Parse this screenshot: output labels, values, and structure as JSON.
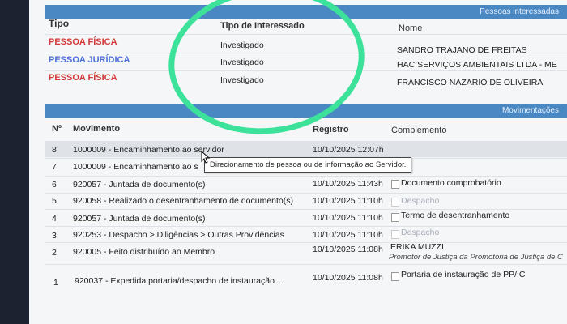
{
  "interessados": {
    "title": "Pessoas interessadas",
    "headers": {
      "tipo": "Tipo",
      "tipo_interessado": "Tipo de Interessado",
      "nome": "Nome"
    },
    "rows": [
      {
        "tipo": "PESSOA FÍSICA",
        "tipo_color": "#d23a3a",
        "interessado": "Investigado",
        "nome": "SANDRO TRAJANO DE FREITAS"
      },
      {
        "tipo": "PESSOA JURÍDICA",
        "tipo_color": "#4d6fd6",
        "interessado": "Investigado",
        "nome": "HAC SERVIÇOS AMBIENTAIS LTDA - ME"
      },
      {
        "tipo": "PESSOA FÍSICA",
        "tipo_color": "#d23a3a",
        "interessado": "Investigado",
        "nome": "FRANCISCO NAZARIO DE OLIVEIRA"
      }
    ]
  },
  "movimentacoes": {
    "title": "Movimentações",
    "headers": {
      "num": "Nº",
      "movimento": "Movimento",
      "registro": "Registro",
      "complemento": "Complemento"
    },
    "rows": [
      {
        "num": "8",
        "movimento": "1000009 - Encaminhamento ao servidor",
        "registro": "10/10/2025 12:07h",
        "complemento": ""
      },
      {
        "num": "7",
        "movimento": "1000009 - Encaminhamento ao s",
        "registro": "",
        "complemento": ""
      },
      {
        "num": "6",
        "movimento": "920057 - Juntada de documento(s)",
        "registro": "10/10/2025 11:43h",
        "complemento": "Documento comprobatório"
      },
      {
        "num": "5",
        "movimento": "920058 - Realizado o desentranhamento de documento(s)",
        "registro": "10/10/2025 11:10h",
        "complemento": "Despacho"
      },
      {
        "num": "4",
        "movimento": "920057 - Juntada de documento(s)",
        "registro": "10/10/2025 11:10h",
        "complemento": "Termo de desentranhamento"
      },
      {
        "num": "3",
        "movimento": "920253 - Despacho > Diligências > Outras Providências",
        "registro": "10/10/2025 11:10h",
        "complemento": "Despacho"
      },
      {
        "num": "2",
        "movimento": "920005 - Feito distribuído ao Membro",
        "registro": "10/10/2025 11:08h",
        "complemento": "ERIKA MUZZI",
        "complemento_sub": "Promotor de Justiça da Promotoria de Justiça de C"
      },
      {
        "num": "1",
        "movimento": "920037 - Expedida portaria/despacho de instauração ...",
        "registro": "10/10/2025 11:08h",
        "complemento": "Portaria de instauração de PP/IC"
      }
    ]
  },
  "tooltip": "Direcionamento de pessoa ou de informação ao Servidor.",
  "colors": {
    "section_bar": "#4a88c4",
    "annotation": "#3ce19a"
  }
}
